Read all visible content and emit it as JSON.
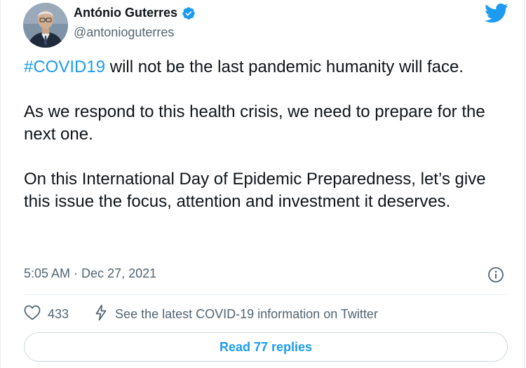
{
  "author": {
    "display_name": "António Guterres",
    "handle": "@antonioguterres",
    "verified_icon": "verified-badge-icon",
    "avatar_icon": "profile-photo"
  },
  "tweet": {
    "hashtag": "#COVID19",
    "line1_rest": " will not be the last pandemic humanity will face.",
    "paragraph2": "As we respond to this health crisis, we need to prepare for the next one.",
    "paragraph3": "On this International Day of Epidemic Preparedness, let’s give this issue the focus, attention and investment it deserves.",
    "timestamp": "5:05 AM · Dec 27, 2021"
  },
  "actions": {
    "like_icon": "heart-icon",
    "like_count": "433",
    "covid_icon": "lightning-icon",
    "covid_text": "See the latest COVID-19 information on Twitter",
    "info_icon": "info-icon"
  },
  "replies": {
    "label": "Read 77 replies"
  },
  "colors": {
    "accent": "#1d9bf0",
    "text": "#0f1419",
    "muted": "#536471"
  }
}
